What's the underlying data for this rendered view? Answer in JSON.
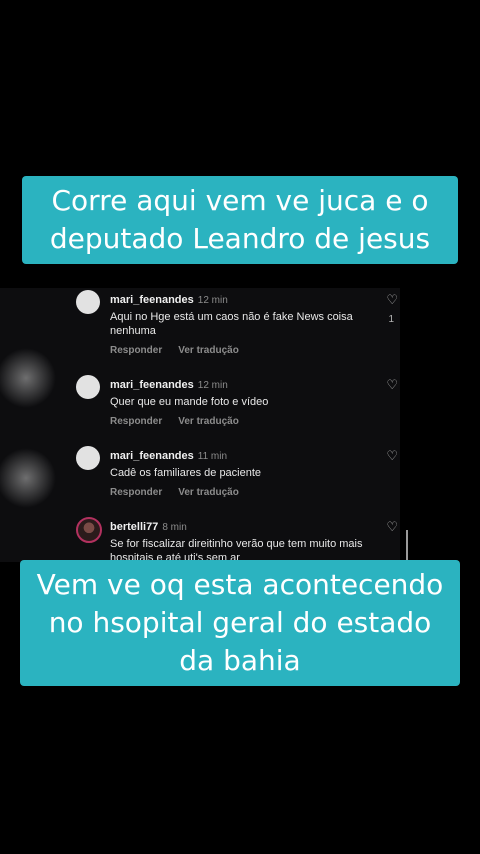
{
  "captions": {
    "top": "Corre aqui vem ve juca e o deputado Leandro de jesus",
    "bottom": "Vem ve oq esta acontecendo no hsopital geral do estado da bahia"
  },
  "actions": {
    "reply": "Responder",
    "translate": "Ver tradução"
  },
  "comments": [
    {
      "user": "mari_feenandes",
      "time": "12 min",
      "text": "Aqui no Hge está um caos não é fake News coisa nenhuma",
      "likes": "1"
    },
    {
      "user": "mari_feenandes",
      "time": "12 min",
      "text": "Quer que eu mande foto e vídeo"
    },
    {
      "user": "mari_feenandes",
      "time": "11 min",
      "text": "Cadê os familiares de paciente"
    },
    {
      "user": "bertelli77",
      "time": "8 min",
      "text": "Se for fiscalizar direitinho verão que tem muito mais hospitais e até uti's sem ar"
    }
  ],
  "icons": {
    "like": "heart-outline-icon"
  },
  "colors": {
    "caption_bg": "#2bb3c0",
    "background": "#000000"
  }
}
